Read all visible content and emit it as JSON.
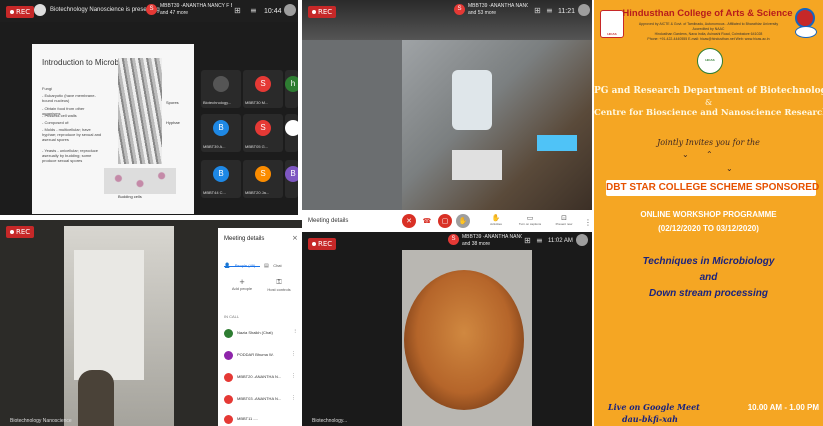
{
  "q1": {
    "rec_label": "REC",
    "presenter_label": "Biotechnology Nanoscience is presenting",
    "header_names": "MBBT39 -ANANTHA NANCY F BSC BIOT...",
    "header_more": "and 47 more",
    "time": "10:44",
    "slide": {
      "title": "Introduction to Microbiology",
      "bullets": [
        "Fungi",
        "- Eukaryotic (have membrane-bound nucleus)",
        "- Obtain food from other organisms",
        "- Possess cell walls",
        "- Composed of:",
        "   - Molds - multicellular; have hyphae; reproduce by sexual and asexual spores",
        "   - Yeasts - unicellular; reproduce asexually by budding; some produce sexual spores"
      ],
      "label_spores": "Spores",
      "label_hyphae": "Hyphae",
      "label_budding": "Budding cells"
    },
    "tiles": [
      {
        "initial": "",
        "name": "Biotechnology...",
        "color": "#3a3a3a"
      },
      {
        "initial": "S",
        "name": "MBBT30 M...",
        "color": "#e53935"
      },
      {
        "initial": "h",
        "name": "Haza Mehta",
        "color": "#2e7d32"
      },
      {
        "initial": "B",
        "name": "MBBT39 A...",
        "color": "#1e88e5"
      },
      {
        "initial": "S",
        "name": "MBBT05 G...",
        "color": "#e53935"
      },
      {
        "initial": "",
        "name": "MBBT09 V...",
        "color": "#ffffff"
      },
      {
        "initial": "B",
        "name": "MBBT44 C...",
        "color": "#1e88e5"
      },
      {
        "initial": "S",
        "name": "MBBT20 Ja...",
        "color": "#fb8c00"
      },
      {
        "initial": "B",
        "name": "MBBT43 K...",
        "color": "#7e57c2"
      }
    ]
  },
  "q2": {
    "rec_label": "REC",
    "header_names": "MBBT39 -ANANTHA NANCY F BSC BIOT...",
    "header_more": "and 53 more",
    "time": "11:21"
  },
  "q3": {
    "rec_label": "REC",
    "bottom_label": "Biotechnology Nanoscience",
    "panel_title": "Meeting details",
    "tab_people": "People (49)",
    "tab_chat": "Chat",
    "add_people": "Add people",
    "host_controls": "Host controls",
    "in_call": "IN CALL",
    "participants": [
      {
        "name": "Nazia Shaikh (Chat)",
        "color": "#2e7d32"
      },
      {
        "name": "PODDAR Bhuma W.",
        "color": "#8e24aa"
      },
      {
        "name": "MBBT20 -ANANTHA N...",
        "color": "#e53935"
      },
      {
        "name": "MBBT03 -ANANTHA N...",
        "color": "#e53935"
      },
      {
        "name": "MBBT11 -...",
        "color": "#e53935"
      }
    ]
  },
  "q4": {
    "rec_label": "REC",
    "meeting_details": "Meeting details",
    "header_names": "MBBT39 -ANANTHA NANCY F BSC BIOT...",
    "header_more": "and 38 more",
    "time": "11:02 AM",
    "actions": [
      "Activities",
      "Turn on captions",
      "Present now"
    ],
    "bottom_label": "Biotechnology..."
  },
  "poster": {
    "college": "Hindusthan College of Arts & Science",
    "approval": "Approved by AICTE & Govt. of Tamilnadu, Autonomous - Affiliated to Bharathiar University",
    "accredited": "Accredited by NAAC",
    "address": "Hindusthan Gardens, Nava India, Avinashi Road, Coimbatore 641028",
    "contact": "Phone: +91-422-4440555 E-mail: hicas@hindusthan.net Web: www.hicas.ac.in",
    "logo_left_text": "HICAS",
    "logo_right_text": "HICAS",
    "dept_line1": "PG and Research Department of Biotechnology",
    "amp": "&",
    "dept_line2": "Centre for Bioscience and Nanoscience Research",
    "invite": "Jointly Invites you for the",
    "banner": "DBT STAR COLLEGE SCHEME SPONSORED",
    "workshop": "ONLINE WORKSHOP PROGRAMME",
    "dates": "(02/12/2020 TO 03/12/2020)",
    "topic1": "Techniques in Microbiology",
    "topic_and": "and",
    "topic2": "Down stream processing",
    "platform": "Live on Google Meet",
    "code": "dau-bkfi-xah",
    "time": "10.00 AM - 1.00 PM",
    "colors": {
      "bg": "#f5a623",
      "dept": "#fff8e1",
      "banner_bg": "#ffffff",
      "banner_text": "#e65100",
      "workshop": "#ffffff",
      "topic": "#1a237e"
    }
  }
}
